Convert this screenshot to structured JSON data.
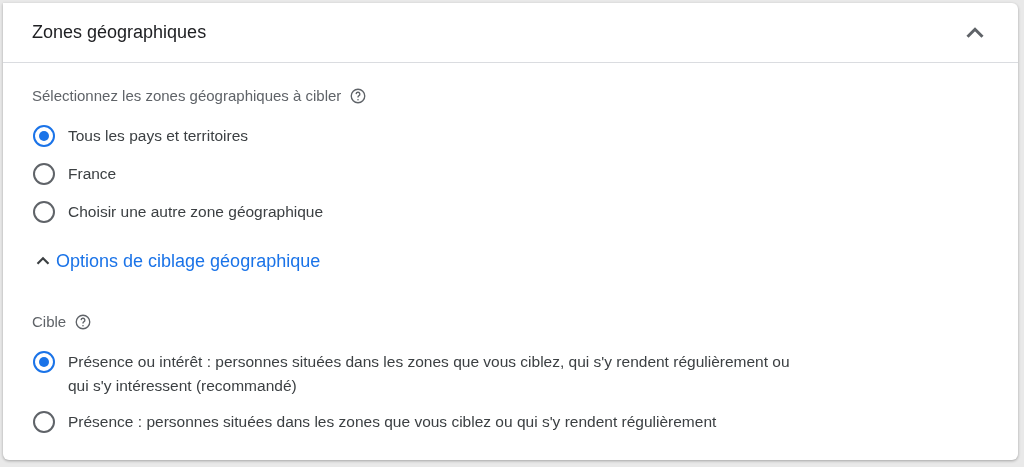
{
  "panel": {
    "title": "Zones géographiques",
    "expanded": true
  },
  "zones": {
    "label": "Sélectionnez les zones géographiques à cibler",
    "options": [
      {
        "label": "Tous les pays et territoires",
        "selected": true
      },
      {
        "label": "France",
        "selected": false
      },
      {
        "label": "Choisir une autre zone géographique",
        "selected": false
      }
    ]
  },
  "options_link": {
    "label": "Options de ciblage géographique",
    "expanded": true
  },
  "target": {
    "label": "Cible",
    "options": [
      {
        "label": "Présence ou intérêt : personnes situées dans les zones que vous ciblez, qui s'y rendent régulièrement ou qui s'y intéressent (recommandé)",
        "selected": true
      },
      {
        "label": "Présence : personnes situées dans les zones que vous ciblez ou qui s'y rendent régulièrement",
        "selected": false
      }
    ]
  }
}
